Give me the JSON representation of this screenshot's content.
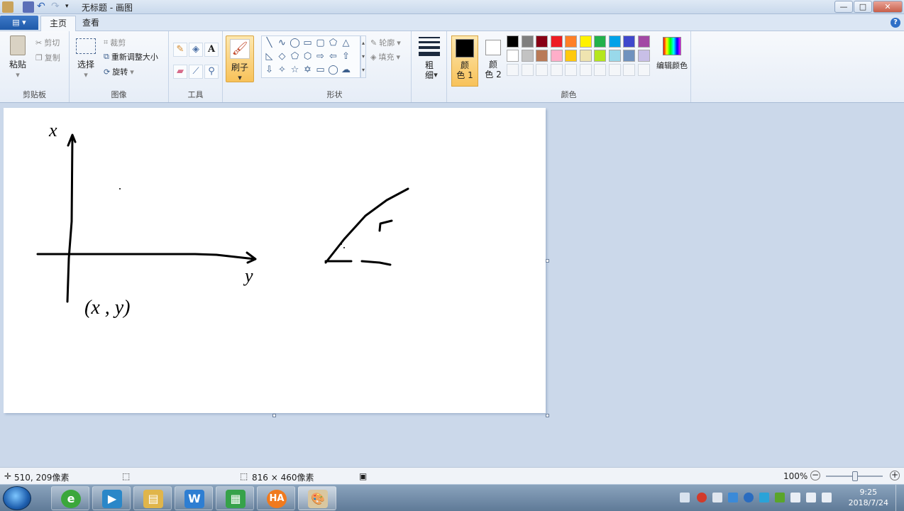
{
  "window": {
    "title": "无标题 - 画图",
    "controls": {
      "minimize": "—",
      "maximize": "□",
      "close": "✕"
    }
  },
  "tabs": {
    "menu_label": "▤ ▾",
    "home": "主页",
    "view": "查看"
  },
  "ribbon": {
    "clipboard": {
      "label": "剪贴板",
      "paste": "粘贴",
      "cut": "剪切",
      "copy": "复制"
    },
    "image": {
      "label": "图像",
      "select": "选择",
      "crop": "裁剪",
      "resize": "重新调整大小",
      "rotate": "旋转"
    },
    "tools": {
      "label": "工具"
    },
    "brushes": {
      "label": "刷子"
    },
    "shapes": {
      "label": "形状",
      "outline": "轮廓",
      "fill": "填充"
    },
    "size": {
      "label": "粗\n细"
    },
    "colors": {
      "label": "颜色",
      "color1_label": "颜\n色 1",
      "color2_label": "颜\n色 2",
      "edit_label": "编辑颜色",
      "color1": "#000000",
      "color2": "#ffffff",
      "palette_row1": [
        "#000000",
        "#7f7f7f",
        "#880015",
        "#ed1c24",
        "#ff7f27",
        "#fff200",
        "#22b14c",
        "#00a2e8",
        "#3f48cc",
        "#a349a4"
      ],
      "palette_row2": [
        "#ffffff",
        "#c3c3c3",
        "#b97a57",
        "#ffaec9",
        "#ffc90e",
        "#efe4b0",
        "#b5e61d",
        "#99d9ea",
        "#7092be",
        "#c8bfe7"
      ]
    }
  },
  "status": {
    "cursor_pos": "510, 209像素",
    "canvas_size": "816 × 460像素",
    "zoom": "100%"
  },
  "taskbar": {
    "clock_time": "9:25",
    "clock_date": "2018/7/24",
    "apps": [
      "browser-icon",
      "video-icon",
      "folder-icon",
      "wps-writer-icon",
      "spreadsheet-icon",
      "ha-icon",
      "paint-icon"
    ]
  },
  "drawing_text": {
    "label_x": "x",
    "label_y": "y",
    "label_pair": "(x , y)",
    "label_r": "r"
  }
}
